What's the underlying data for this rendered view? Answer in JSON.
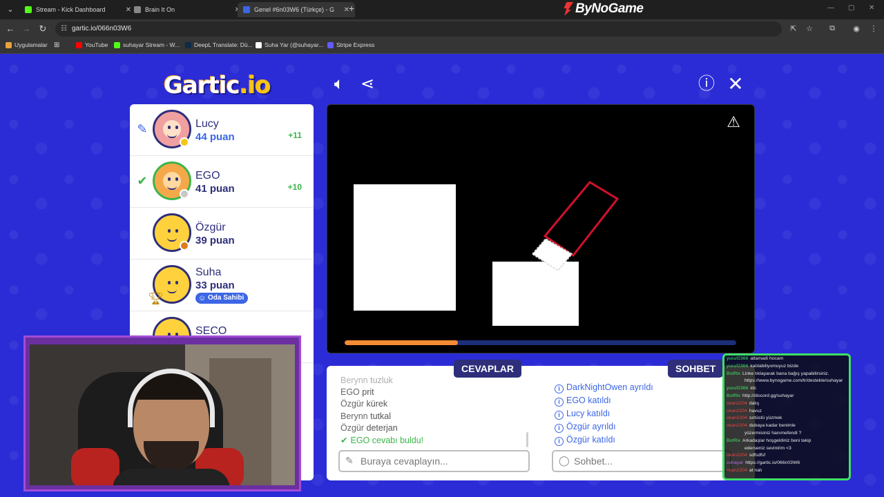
{
  "browser": {
    "tabs": [
      {
        "title": "Stream - Kick Dashboard",
        "favicon_color": "#53fc18",
        "active": false,
        "left": 0
      },
      {
        "title": "Brain It On",
        "favicon_color": "#888888",
        "active": false
      },
      {
        "title": "Genel #6n03W6 (Türkçe) - G",
        "favicon_color": "#3c66e6",
        "active": true
      }
    ],
    "new_tab_symbol": "+",
    "brand": "ByNoGame",
    "url": "gartic.io/066n03W6",
    "bookmarks": [
      {
        "label": "Uygulamalar",
        "icon_color": "#e8a33d"
      },
      {
        "label": "YouTube",
        "icon_color": "#ff0000"
      },
      {
        "label": "suhayar Stream - W...",
        "icon_color": "#53fc18"
      },
      {
        "label": "DeepL Translate: Dü...",
        "icon_color": "#0f2b46"
      },
      {
        "label": "Suha Yar (@suhayar...",
        "icon_color": "#ffffff"
      },
      {
        "label": "Stripe Express",
        "icon_color": "#635bff"
      }
    ]
  },
  "game": {
    "logo": {
      "main": "Gartic",
      "dot": ".io"
    },
    "players": [
      {
        "name": "Lucy",
        "points": "44 puan",
        "gain": "+11",
        "status": "drawing",
        "avatar_color": "#f0a0a0",
        "badge_color": "#f5c518"
      },
      {
        "name": "EGO",
        "points": "41 puan",
        "gain": "+10",
        "status": "guessed",
        "avatar_color": "#f5a84a",
        "badge_color": "#c8c8c8"
      },
      {
        "name": "Özgür",
        "points": "39 puan",
        "gain": "",
        "status": "none",
        "avatar_color": "#ffd23d",
        "badge_color": "#e07a1f"
      },
      {
        "name": "Suha",
        "points": "33 puan",
        "gain": "",
        "status": "host",
        "avatar_color": "#ffd23d",
        "badge_color": "",
        "host_label": "Oda Sahibi",
        "rank": "3"
      },
      {
        "name": "SECO",
        "points": "",
        "gain": "",
        "status": "none",
        "avatar_color": "#ffd23d",
        "badge_color": ""
      }
    ],
    "timer_progress": 0.29,
    "answers_tab": "CEVAPLAR",
    "chat_tab": "SOHBET",
    "answers": [
      {
        "user": "Berynn",
        "text": "tuzluk",
        "faded": true
      },
      {
        "user": "EGO",
        "text": "prit",
        "faded": false
      },
      {
        "user": "Özgür",
        "text": "kürek",
        "faded": false
      },
      {
        "user": "Berynn",
        "text": "tutkal",
        "faded": false
      },
      {
        "user": "Özgür",
        "text": "deterjan",
        "faded": false
      }
    ],
    "correct_answer": {
      "user": "EGO",
      "text": "cevabı buldu!"
    },
    "answer_placeholder": "Buraya cevaplayın...",
    "chat": [
      {
        "user": "DarkNightOwen",
        "action": "ayrıldı"
      },
      {
        "user": "EGO",
        "action": "katıldı"
      },
      {
        "user": "Lucy",
        "action": "katıldı"
      },
      {
        "user": "Özgür",
        "action": "ayrıldı"
      },
      {
        "user": "Özgür",
        "action": "katıldı"
      }
    ],
    "chat_placeholder": "Sohbet..."
  },
  "stream_chat": [
    {
      "user": "yusuf2366",
      "user_color": "#3ee066",
      "msg": "atlamadi hocam"
    },
    {
      "user": "yusuf2366",
      "user_color": "#3ee066",
      "msg": "katılabiliyomuyuz bizde"
    },
    {
      "user": "BotRix",
      "user_color": "#3ee066",
      "msg": "Linke tıklayarak bana bağış yapabilirsiniz."
    },
    {
      "user": "",
      "user_color": "#3ee066",
      "msg": "https://www.bynogame.com/tr/destekle/suhayar"
    },
    {
      "user": "yusuf2366",
      "user_color": "#3ee066",
      "msg": "idc"
    },
    {
      "user": "BotRix",
      "user_color": "#3ee066",
      "msg": "http://discord.gg/suhayar"
    },
    {
      "user": "okan2204",
      "user_color": "#e84545",
      "msg": "dalış"
    },
    {
      "user": "okan2204",
      "user_color": "#e84545",
      "msg": "havuz"
    },
    {
      "user": "okan2204",
      "user_color": "#e84545",
      "msg": "sırtüstü yüzmek"
    },
    {
      "user": "okan2204",
      "user_color": "#e84545",
      "msg": "dubaya kadar benimle"
    },
    {
      "user": "",
      "user_color": "#e84545",
      "msg": "yüzermisiniz hanımefendi ?"
    },
    {
      "user": "BotRix",
      "user_color": "#3ee066",
      "msg": "Arkadaşlar hoşgeldiniz beni takip"
    },
    {
      "user": "",
      "user_color": "#3ee066",
      "msg": "ederseniz sevinirim <3"
    },
    {
      "user": "okan2204",
      "user_color": "#e84545",
      "msg": "sdfsdfsf"
    },
    {
      "user": "suhayar",
      "user_color": "#b070e0",
      "msg": "https://gartic.io/066n03W6"
    },
    {
      "user": "okan2204",
      "user_color": "#e84545",
      "msg": "at nalı"
    }
  ]
}
